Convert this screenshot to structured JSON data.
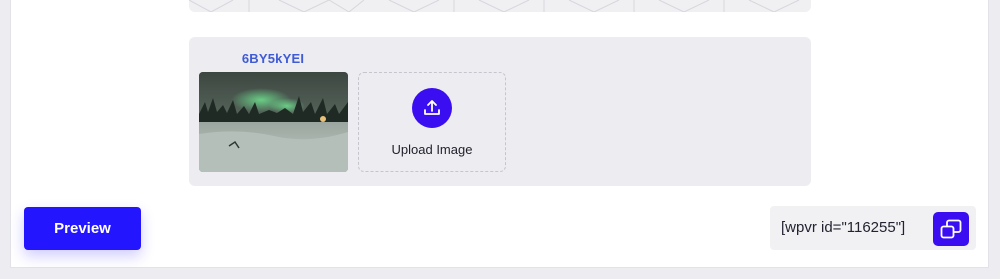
{
  "scene": {
    "id": "6BY5kYEI",
    "thumbnail_icon": "aurora-panorama-thumbnail"
  },
  "upload": {
    "label": "Upload Image",
    "icon": "upload-icon"
  },
  "actions": {
    "preview_label": "Preview"
  },
  "shortcode": {
    "text": "[wpvr id=\"116255\"]",
    "copy_icon": "copy-icon"
  },
  "colors": {
    "accent": "#3a0ef0",
    "preview_button": "#2415ff",
    "scene_id": "#3f5bd6",
    "panel_bg": "#ececf1"
  }
}
